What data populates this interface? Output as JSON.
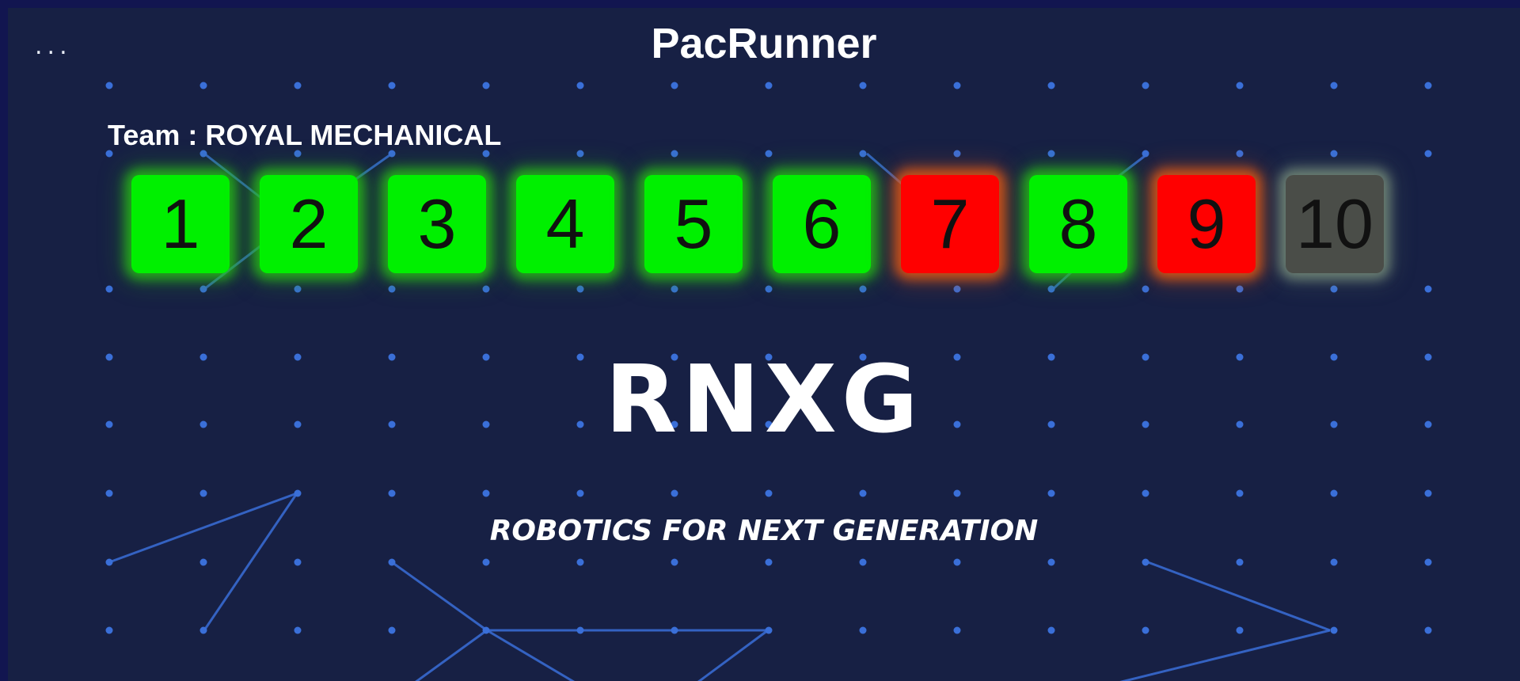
{
  "app": {
    "title": "PacRunner",
    "menu_glyph": "..."
  },
  "team": {
    "label": "Team : ROYAL MECHANICAL"
  },
  "levels": [
    {
      "number": "1",
      "status": "completed"
    },
    {
      "number": "2",
      "status": "completed"
    },
    {
      "number": "3",
      "status": "completed"
    },
    {
      "number": "4",
      "status": "completed"
    },
    {
      "number": "5",
      "status": "completed"
    },
    {
      "number": "6",
      "status": "completed"
    },
    {
      "number": "7",
      "status": "failed"
    },
    {
      "number": "8",
      "status": "completed"
    },
    {
      "number": "9",
      "status": "failed"
    },
    {
      "number": "10",
      "status": "locked"
    }
  ],
  "branding": {
    "logo_text": "RNXG",
    "tagline": "ROBOTICS FOR NEXT GENERATION"
  },
  "colors": {
    "background": "#172044",
    "border": "#121550",
    "completed": "#00f000",
    "failed": "#ff0000",
    "locked": "#4a4d48",
    "network": "#3a6fd8"
  }
}
